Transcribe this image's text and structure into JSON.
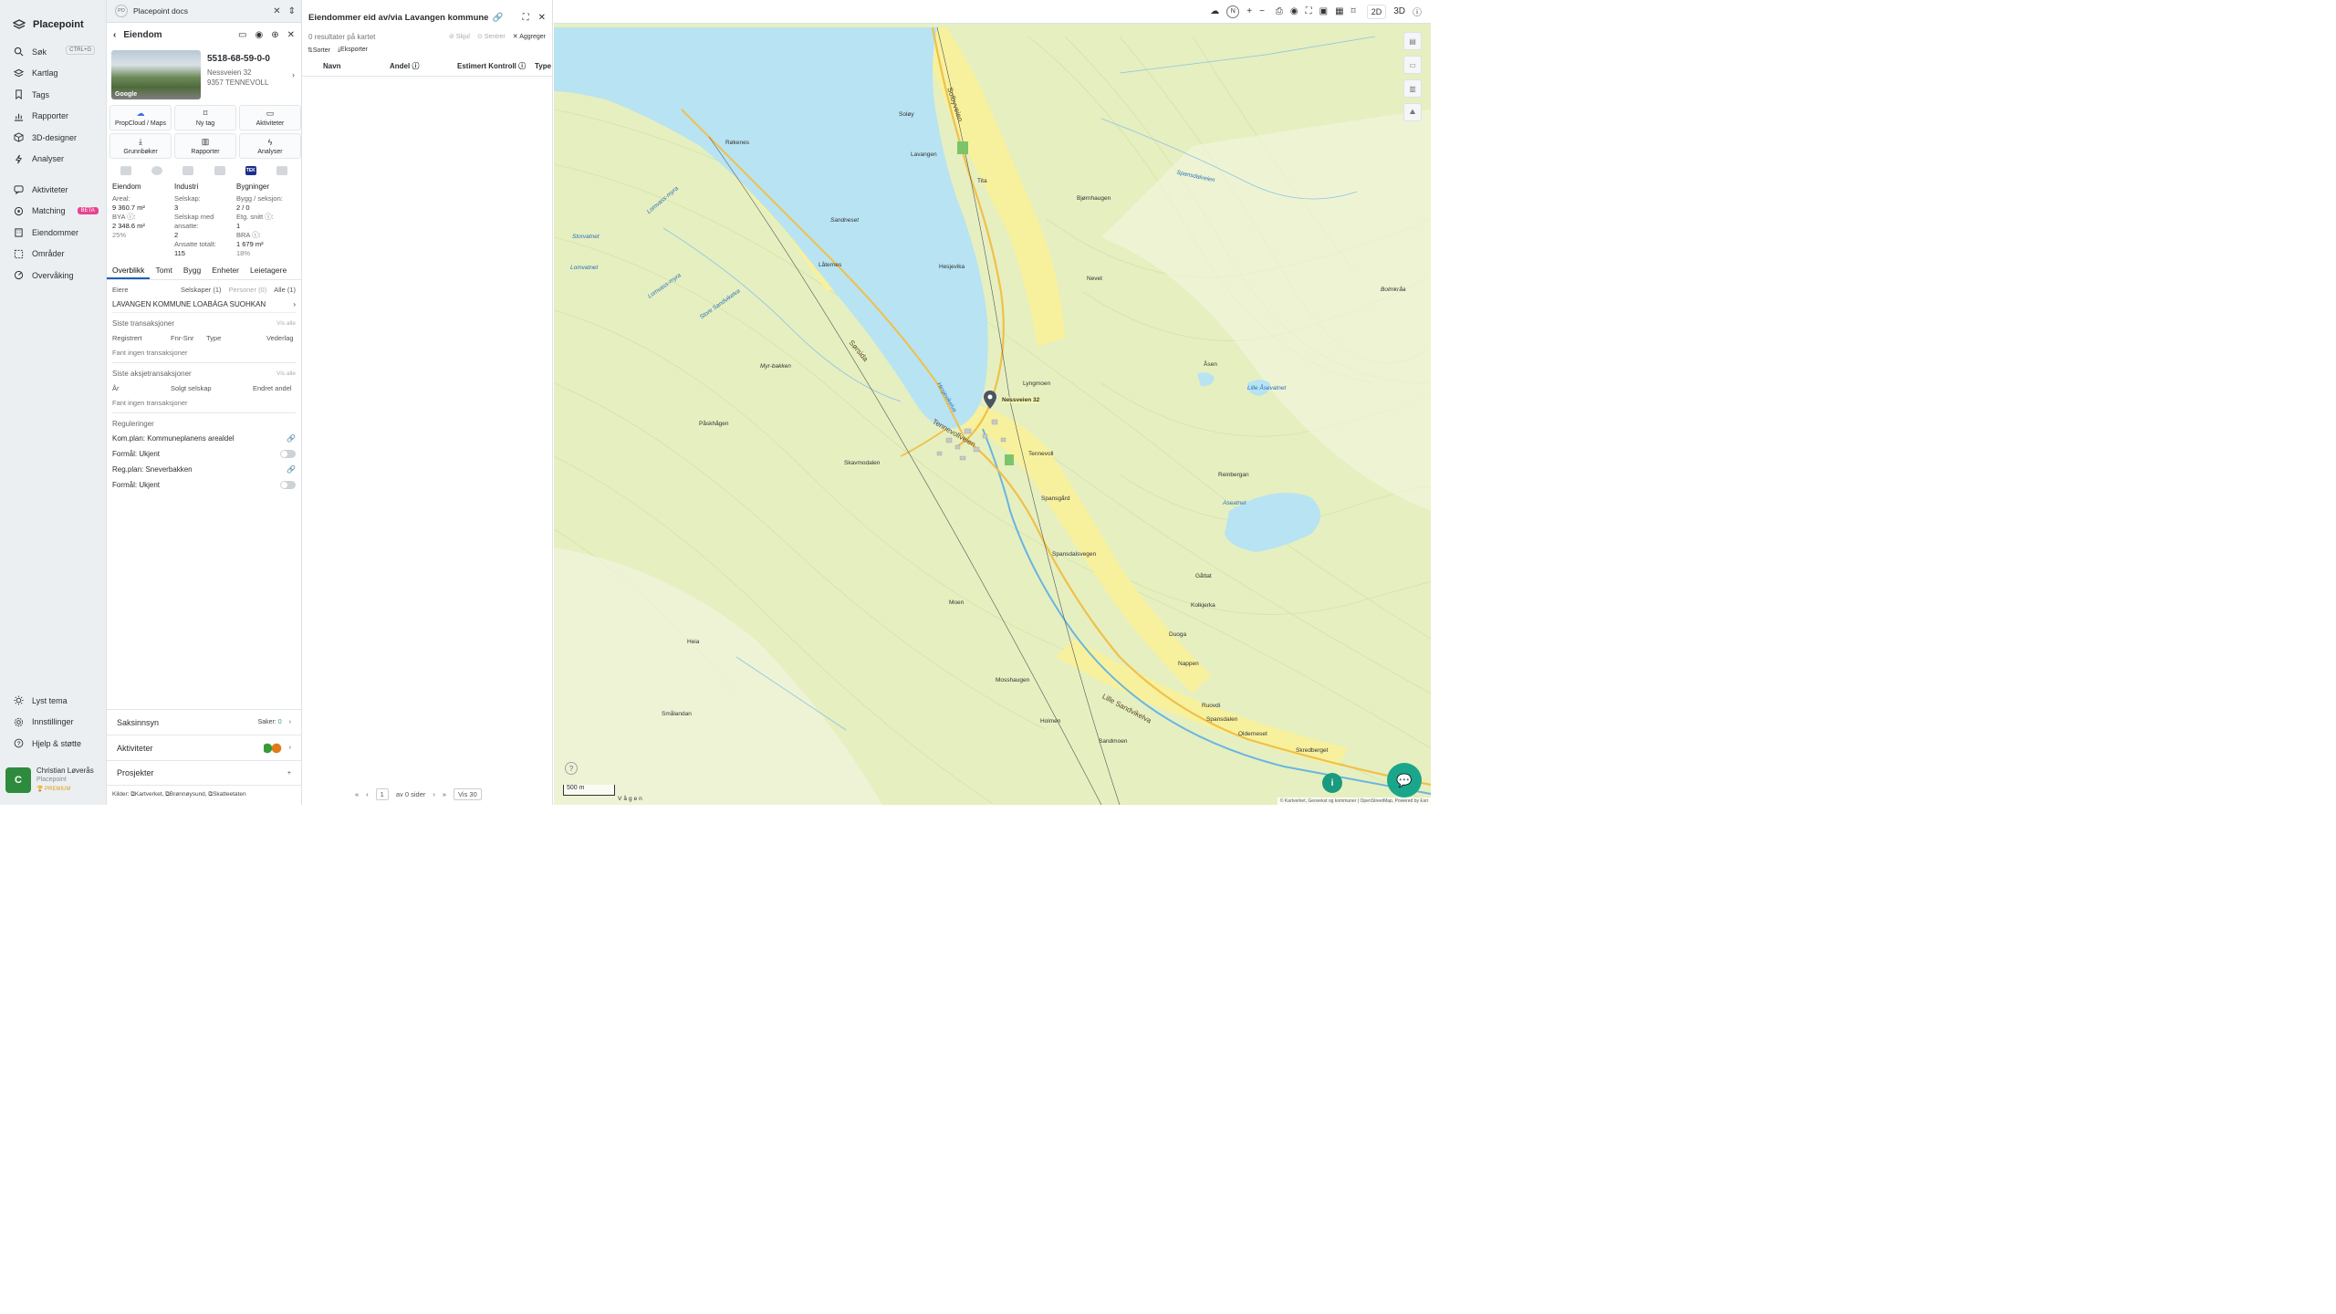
{
  "app": {
    "name": "Placepoint"
  },
  "nav": {
    "items": [
      {
        "label": "Søk",
        "shortcut": "CTRL+G"
      },
      {
        "label": "Kartlag"
      },
      {
        "label": "Tags"
      },
      {
        "label": "Rapporter"
      },
      {
        "label": "3D-designer"
      },
      {
        "label": "Analyser"
      },
      {
        "label": "Aktiviteter"
      },
      {
        "label": "Matching",
        "badge": "BETA"
      },
      {
        "label": "Eiendommer"
      },
      {
        "label": "Områder"
      },
      {
        "label": "Overvåking"
      }
    ],
    "bottom": [
      {
        "label": "Lyst tema"
      },
      {
        "label": "Innstillinger"
      },
      {
        "label": "Hjelp & støtte"
      }
    ],
    "user": {
      "initial": "C",
      "name": "Christian Løverås",
      "org": "Placepoint",
      "plan": "PREMIUM"
    }
  },
  "tab": {
    "logo": "PD",
    "title": "Placepoint docs"
  },
  "property": {
    "header": "Eiendom",
    "thumb_label": "Google",
    "id": "5518-68-59-0-0",
    "street": "Nessveien 32",
    "postal": "9357 TENNEVOLL",
    "actions": [
      {
        "label": "PropCloud / Maps",
        "icon": "cloud-icon"
      },
      {
        "label": "Ny tag",
        "icon": "bookmark-icon"
      },
      {
        "label": "Aktiviteter",
        "icon": "chat-icon"
      },
      {
        "label": "Grunnbøker",
        "icon": "download-icon"
      },
      {
        "label": "Rapporter",
        "icon": "chart-icon"
      },
      {
        "label": "Analyser",
        "icon": "bolt-icon"
      }
    ],
    "tek_label": "TEK",
    "facts": {
      "eiendom": {
        "title": "Eiendom",
        "areal_label": "Areal:",
        "areal": "9 360.7 m²",
        "bya_label": "BYA ⓘ:",
        "bya": "2 348.6 m²",
        "bya_pct": "25%"
      },
      "industri": {
        "title": "Industri",
        "selskap_label": "Selskap:",
        "selskap": "3",
        "ansatte_label": "Selskap med ansatte:",
        "ansatte": "2",
        "total_label": "Ansatte totalt:",
        "total": "115"
      },
      "bygninger": {
        "title": "Bygninger",
        "bygg_label": "Bygg / seksjon:",
        "bygg": "2 / 0",
        "etg_label": "Etg. snitt ⓘ:",
        "etg": "1",
        "bra_label": "BRA ⓘ:",
        "bra": "1 679 m²",
        "bra_pct": "18%"
      }
    },
    "tabs": [
      "Overblikk",
      "Tomt",
      "Bygg",
      "Enheter",
      "Leietagere"
    ],
    "owners_label": "Eiere",
    "owner_filters": [
      "Selskaper (1)",
      "Personer (0)",
      "Alle (1)"
    ],
    "owner": "LAVANGEN KOMMUNE LOABÁGA SUOHKAN",
    "transactions": {
      "title": "Siste transaksjoner",
      "link": "Vis alle",
      "cols": [
        "Registrert",
        "Fnr-Snr",
        "Type",
        "Vederlag"
      ],
      "empty": "Fant ingen transaksjoner"
    },
    "share_tx": {
      "title": "Siste aksjetransaksjoner",
      "link": "Vis alle",
      "cols": [
        "År",
        "Solgt selskap",
        "Endret andel"
      ],
      "empty": "Fant ingen transaksjoner"
    },
    "regs": {
      "title": "Reguleringer",
      "items": [
        {
          "label": "Kom.plan: Kommuneplanens arealdel"
        },
        {
          "label": "Formål: Ukjent"
        },
        {
          "label": "Reg.plan: Sneverbakken"
        },
        {
          "label": "Formål: Ukjent"
        }
      ]
    },
    "accordions": [
      {
        "label": "Saksinnsyn",
        "meta": "Saker:",
        "count": "0"
      },
      {
        "label": "Aktiviteter"
      },
      {
        "label": "Prosjekter",
        "meta": "+"
      }
    ],
    "sources": {
      "label": "Kilder:",
      "items": [
        "Kartverket",
        "Brønnøysund",
        "Skatteetaten"
      ]
    }
  },
  "results": {
    "title": "Eiendommer eid av/via Lavangen kommune",
    "count_text": "0 resultater på kartet",
    "actions": [
      "Skjul",
      "Sentrer",
      "Aggreger"
    ],
    "tools": [
      "Sorter",
      "Eksporter"
    ],
    "columns": [
      "Navn",
      "Andel ⓘ",
      "Estimert Kontroll ⓘ",
      "Type"
    ],
    "pager": {
      "page": "1",
      "of_text": "av 0 sider",
      "per_page": "Vis 30"
    }
  },
  "map": {
    "top_buttons": [
      "2D",
      "3D"
    ],
    "scale": "500 m",
    "marker": "Nessveien 32",
    "attribution": "© Kartverket, Geovekst og kommuner | OpenStreetMap, Powered by Esri",
    "places": [
      "Solbyveien",
      "Soløy",
      "Lavangen",
      "Tita",
      "Bjørnhaugen",
      "Røkenes",
      "Sandneset",
      "Låternes",
      "Hesjevika",
      "Nevet",
      "Bolmkråa",
      "Åsen",
      "Lille Åsevatnet",
      "Lyngmoen",
      "Tennevoll",
      "Tennevollveien",
      "Påskhågen",
      "Skavmodalen",
      "Myr-bakken",
      "Spansgård",
      "Spansdalsvegen",
      "Sørsida",
      "Gåttat",
      "Kolkjerka",
      "Moen",
      "Duoga",
      "Nappen",
      "Heia",
      "Smålandan",
      "Mosshaugen",
      "Holmen",
      "Sandmoen",
      "Skredberget",
      "Ruovdi",
      "Spansdalen",
      "Olderneset",
      "Aseatnet",
      "Reinbergan",
      "Storvatnet",
      "Lomvatnet",
      "Lomvass-myra",
      "Store Sandvikelva",
      "Lille Sandvikelva",
      "Spansdalveien",
      "Hesjevikelva",
      "Vågen",
      "Heia"
    ]
  },
  "colors": {
    "water": "#b8e3f2",
    "forest": "#d9ecb0",
    "field": "#f6f09a",
    "road": "#f2c94c",
    "accent": "#1aa68a"
  }
}
